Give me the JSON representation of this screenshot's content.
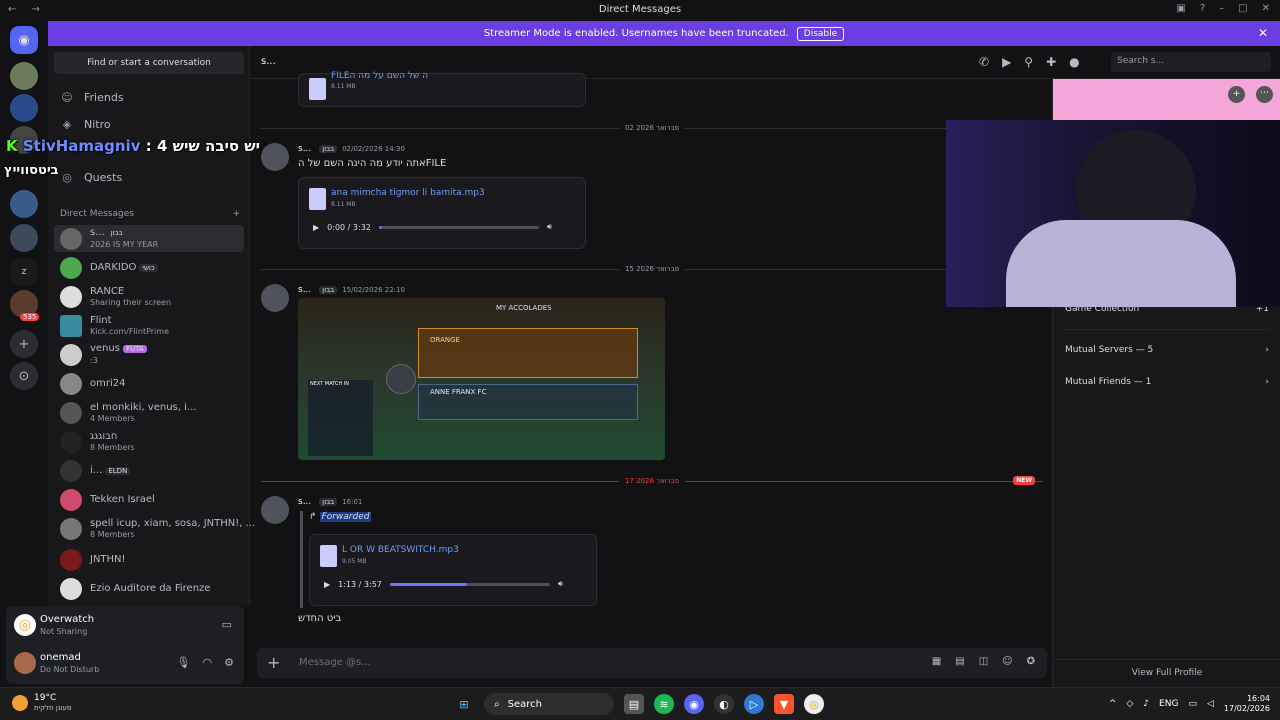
{
  "window": {
    "title": "Direct Messages"
  },
  "banner": {
    "text": "Streamer Mode is enabled. Usernames have been truncated.",
    "button": "Disable"
  },
  "sidebar": {
    "find": "Find or start a conversation",
    "nav": [
      {
        "label": "Friends",
        "icon": "friends-icon"
      },
      {
        "label": "Nitro",
        "icon": "nitro-icon"
      },
      {
        "label": "Quests",
        "icon": "quests-icon"
      }
    ],
    "dm_header": "Direct Messages",
    "dms": [
      {
        "name": "s...",
        "tag": "בבון",
        "sub": "2026 IS MY YEAR",
        "selected": true
      },
      {
        "name": "DARKIDO",
        "tag": "כושי",
        "sub": ""
      },
      {
        "name": "RANCE",
        "tag": "",
        "sub": "Sharing their screen"
      },
      {
        "name": "Flint",
        "tag": "",
        "sub": "Kick.com/FlintPrime"
      },
      {
        "name": "venus",
        "tag": "FUTA",
        "sub": ":3"
      },
      {
        "name": "omri24",
        "tag": "",
        "sub": ""
      },
      {
        "name": "el monkiki, venus, i...",
        "tag": "",
        "sub": "4 Members"
      },
      {
        "name": "חבוגגג",
        "tag": "",
        "sub": "8 Members"
      },
      {
        "name": "i...",
        "tag": "ELDN",
        "sub": ""
      },
      {
        "name": "Tekken Israel",
        "tag": "",
        "sub": ""
      },
      {
        "name": "spell icup, xiam, sosa, JNTHN!, ...",
        "tag": "",
        "sub": "8 Members"
      },
      {
        "name": "JNTHN!",
        "tag": "",
        "sub": ""
      },
      {
        "name": "Ezio Auditore da Firenze",
        "tag": "",
        "sub": ""
      }
    ]
  },
  "overlay": {
    "kick": "K",
    "user": "StivHamagniv",
    "line1_rest": " : יש סיבה שיש 4",
    "line2": "ביטסווייץ"
  },
  "activity": {
    "game": "Overwatch",
    "status": "Not Sharing"
  },
  "user": {
    "name": "onemad",
    "status": "Do Not Disturb"
  },
  "chat": {
    "header_name": "s...",
    "search_placeholder": "Search s...",
    "prev_file_name": "FILEה של השם על  מה ה",
    "prev_file_size": "8.11 MB",
    "dividers": [
      "02 פברואר 2026",
      "15 פברואר 2026",
      "17 פברואר 2026"
    ],
    "new_label": "NEW",
    "messages": [
      {
        "author": "s...",
        "tag": "בבון",
        "time": "02/02/2026 14:30",
        "text": "אתה יודע מה הינה השם של הFILE",
        "file": "ana mimcha tigmor li bamita.mp3",
        "size": "8.11 MB",
        "player": "0:00 / 3:32",
        "progress": 0.02
      },
      {
        "author": "s...",
        "tag": "בבון",
        "time": "15/02/2026 22:10",
        "image_title": "MY ACCOLADES",
        "team1": "ORANGE",
        "team2": "ANNE FRANX FC",
        "next_match": "NEXT MATCH IN"
      },
      {
        "author": "s...",
        "tag": "בבון",
        "time": "16:01",
        "forwarded": "Forwarded",
        "file": "L OR W BEATSWITCH.mp3",
        "size": "9.05 MB",
        "player": "1:13 / 3:57",
        "progress": 0.48,
        "text": "ביט החדש"
      }
    ],
    "composer_placeholder": "Message @s..."
  },
  "profile": {
    "rows": [
      "Game Collection",
      "Mutual Servers — 5",
      "Mutual Friends — 1"
    ],
    "game_extra": "+1",
    "view_full": "View Full Profile"
  },
  "taskbar": {
    "temp": "19°C",
    "weather_desc": "מעונן חלקית",
    "search": "Search",
    "lang": "ENG",
    "time": "16:04",
    "date": "17/02/2026",
    "mention_count": "535"
  },
  "colors": {
    "accent": "#5865f2",
    "banner": "#6a3ee0",
    "profile_banner": "#f4a6d8",
    "link": "#6b9ef0",
    "new_red": "#f23f43"
  }
}
